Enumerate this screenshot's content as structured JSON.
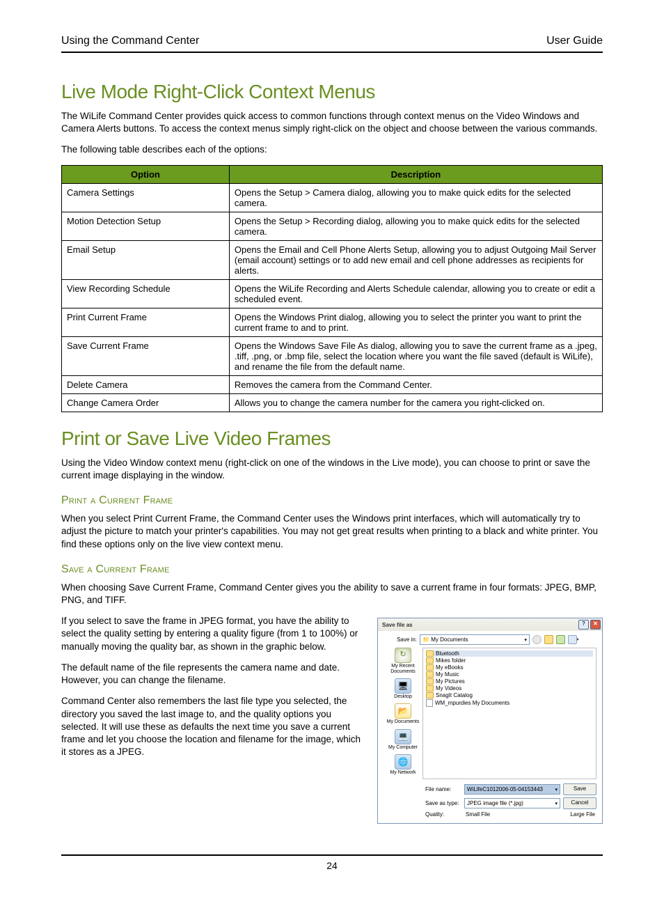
{
  "header": {
    "left": "Using the Command Center",
    "right": "User Guide"
  },
  "section1": {
    "title": "Live Mode Right-Click Context Menus",
    "intro": "The WiLife Command Center provides quick access to common functions through context menus on the Video Windows and Camera Alerts buttons. To access the context menus simply right-click on the object and choose between the various commands.",
    "lead": "The following table describes each of the options:"
  },
  "table": {
    "headers": {
      "option": "Option",
      "description": "Description"
    },
    "rows": [
      {
        "opt": "Camera Settings",
        "desc": "Opens the Setup > Camera dialog, allowing you to make quick edits for the selected camera."
      },
      {
        "opt": "Motion Detection Setup",
        "desc": "Opens the Setup > Recording dialog, allowing you to make quick edits for the selected camera."
      },
      {
        "opt": "Email Setup",
        "desc": "Opens the Email and Cell Phone Alerts Setup, allowing you to adjust Outgoing Mail Server (email account) settings or to add new email and cell phone addresses as recipients for alerts."
      },
      {
        "opt": "View Recording Schedule",
        "desc": "Opens the WiLife Recording and Alerts Schedule calendar, allowing you to create or edit a scheduled event."
      },
      {
        "opt": "Print Current Frame",
        "desc": "Opens the Windows Print dialog, allowing you to select the printer you want to print the current frame to and to print."
      },
      {
        "opt": "Save Current Frame",
        "desc": "Opens the Windows Save File As dialog, allowing you to save the current frame as a .jpeg, .tiff, .png, or .bmp file, select the location where you want the file saved (default is WiLife), and rename the file from the default name."
      },
      {
        "opt": "Delete Camera",
        "desc": "Removes the camera from the Command Center."
      },
      {
        "opt": "Change Camera Order",
        "desc": "Allows you to change the camera number for the camera you right-clicked on."
      }
    ]
  },
  "section2": {
    "title": "Print or Save Live Video Frames",
    "intro": "Using the Video Window context menu (right-click on one of the windows in the Live mode), you can choose to print or save the current image displaying in the window."
  },
  "printSec": {
    "title": "Print a Current Frame",
    "body": "When you select Print Current Frame, the Command Center uses the Windows print interfaces, which will automatically try to adjust the picture to match your printer's capabilities.  You may not get great results when printing to a black and white printer. You find these options only on the live view context menu."
  },
  "saveSec": {
    "title": "Save a Current Frame",
    "p1": "When choosing Save Current Frame, Command Center gives you the ability to save a current frame in four formats: JPEG, BMP, PNG, and TIFF.",
    "p2": "If you select to save the frame in JPEG format, you have the ability to select the quality setting by entering a quality figure (from 1 to 100%) or manually moving the quality bar, as shown in the graphic below.",
    "p3": "The default name of the file represents the camera name and date. However, you can change the filename.",
    "p4": "Command Center also remembers the last file type you selected, the directory you saved the last image to, and the quality options you selected.  It will use these as defaults the next time you save a current frame and let you choose the location and filename for the image, which it stores as a JPEG."
  },
  "dialog": {
    "title": "Save file as",
    "saveInLabel": "Save in:",
    "saveInValue": "My Documents",
    "places": {
      "recent": "My Recent Documents",
      "desktop": "Desktop",
      "mydocs": "My Documents",
      "mycomp": "My Computer",
      "mynet": "My Network"
    },
    "files": [
      "Bluetooth",
      "Mikes folder",
      "My eBooks",
      "My Music",
      "My Pictures",
      "My Videos",
      "SnagIt Catalog",
      "WM_mpurdies My Documents"
    ],
    "fileNameLabel": "File name:",
    "fileNameValue": "WiLifeC1012006-05-04153443",
    "saveAsTypeLabel": "Save as type:",
    "saveAsTypeValue": "JPEG image file (*.jpg)",
    "qualityLabel": "Quality:",
    "smallFile": "Small File",
    "largeFile": "Large File",
    "saveBtn": "Save",
    "cancelBtn": "Cancel"
  },
  "pageNumber": "24"
}
